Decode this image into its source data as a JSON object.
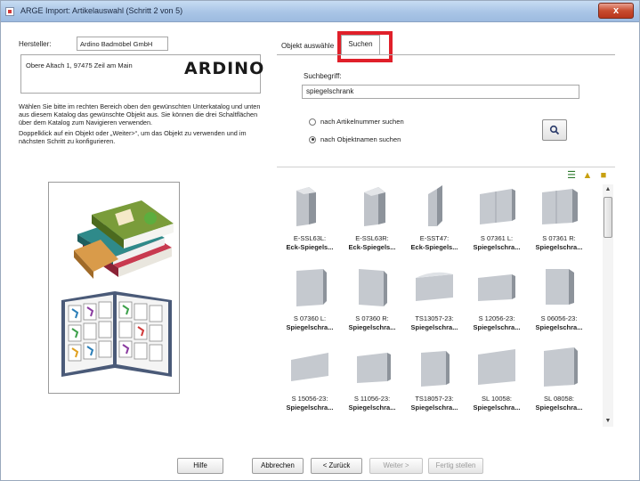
{
  "window": {
    "title": "ARGE Import: Artikelauswahl (Schritt 2 von 5)",
    "close_label": "x"
  },
  "left": {
    "hersteller_label": "Hersteller:",
    "hersteller_value": "Ardino Badmöbel GmbH",
    "address": "Obere Altach 1, 97475 Zeil am Main",
    "logo": "ARDINO",
    "instructions_1": "Wählen Sie bitte im rechten Bereich oben den gewünschten Unterkatalog und unten aus diesem Katalog das gewünschte Objekt aus.  Sie können die drei Schaltflächen über dem Katalog zum Navigieren verwenden.",
    "instructions_2": "Doppelklick auf ein Objekt  oder „Weiter>“, um das Objekt zu verwenden und im nächsten Schritt zu konfigurieren."
  },
  "tabs": {
    "objekt": "Objekt auswähle",
    "suchen": "Suchen"
  },
  "search": {
    "label": "Suchbegriff:",
    "value": "spiegelschrank",
    "radio_artikel": "nach Artikelnummer suchen",
    "radio_objekt": "nach Objektnamen suchen",
    "search_icon": "search-icon"
  },
  "results": {
    "items": [
      {
        "code": "E-SSL63L:",
        "name": "Eck-Spiegels..."
      },
      {
        "code": "E-SSL63R:",
        "name": "Eck-Spiegels..."
      },
      {
        "code": "E-SST47:",
        "name": "Eck-Spiegels..."
      },
      {
        "code": "S 07361 L:",
        "name": "Spiegelschra..."
      },
      {
        "code": "S 07361 R:",
        "name": "Spiegelschra..."
      },
      {
        "code": "S 07360 L:",
        "name": "Spiegelschra..."
      },
      {
        "code": "S 07360 R:",
        "name": "Spiegelschra..."
      },
      {
        "code": "TS13057-23:",
        "name": "Spiegelschra..."
      },
      {
        "code": "S 12056-23:",
        "name": "Spiegelschra..."
      },
      {
        "code": "S 06056-23:",
        "name": "Spiegelschra..."
      },
      {
        "code": "S 15056-23:",
        "name": "Spiegelschra..."
      },
      {
        "code": "S 11056-23:",
        "name": "Spiegelschra..."
      },
      {
        "code": "TS18057-23:",
        "name": "Spiegelschra..."
      },
      {
        "code": "SL 10058:",
        "name": "Spiegelschra..."
      },
      {
        "code": "SL 08058:",
        "name": "Spiegelschra..."
      }
    ]
  },
  "buttons": {
    "hilfe": "Hilfe",
    "abbrechen": "Abbrechen",
    "zurueck": "< Zurück",
    "weiter": "Weiter >",
    "fertig": "Fertig stellen"
  }
}
